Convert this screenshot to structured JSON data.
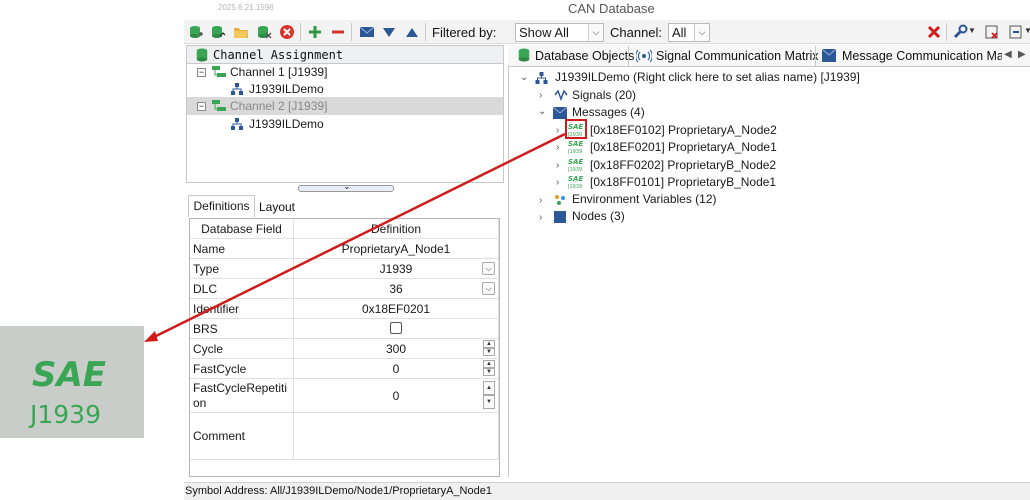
{
  "window": {
    "version": "2025.6.21.1598",
    "title": "CAN Database"
  },
  "toolbar": {
    "filter_label": "Filtered by:",
    "filter_value": "Show All",
    "channel_label": "Channel:",
    "channel_value": "All",
    "icons": [
      "db-add-icon",
      "db-add-alt-icon",
      "folder-open-icon",
      "db-remove-icon",
      "delete-icon",
      "add-icon",
      "remove-icon",
      "mail-icon",
      "arrow-down-icon",
      "arrow-up-icon",
      "close-icon",
      "wrench-icon",
      "export-icon",
      "import-icon"
    ]
  },
  "channel_pane": {
    "title": "Channel Assignment",
    "items": [
      {
        "label": "Channel 1 [J1939]",
        "child": "J1939ILDemo"
      },
      {
        "label": "Channel 2 [J1939]",
        "child": "J1939ILDemo"
      }
    ]
  },
  "def_tabs": [
    "Definitions",
    "Layout"
  ],
  "definitions": {
    "headers": [
      "Database Field",
      "Definition"
    ],
    "rows": [
      {
        "field": "Name",
        "value": "ProprietaryA_Node1"
      },
      {
        "field": "Type",
        "value": "J1939"
      },
      {
        "field": "DLC",
        "value": "36"
      },
      {
        "field": "Identifier",
        "value": "0x18EF0201"
      },
      {
        "field": "BRS",
        "value": ""
      },
      {
        "field": "Cycle",
        "value": "300"
      },
      {
        "field": "FastCycle",
        "value": "0"
      },
      {
        "field": "FastCycleRepetition",
        "value": "0"
      },
      {
        "field": "Comment",
        "value": ""
      }
    ],
    "brs_checked": false
  },
  "right_tabs": [
    "Database Objects",
    "Signal Communication Matrix",
    "Message Communication Matr"
  ],
  "db_tree": {
    "root": "J1939ILDemo (Right click here to set alias name) [J1939]",
    "signals": "Signals (20)",
    "messages": "Messages (4)",
    "message_items": [
      "[0x18EF0102] ProprietaryA_Node2",
      "[0x18EF0201] ProprietaryA_Node1",
      "[0x18FF0202] ProprietaryB_Node2",
      "[0x18FF0101] ProprietaryB_Node1"
    ],
    "env": "Environment Variables (12)",
    "nodes": "Nodes (3)"
  },
  "status": {
    "text": "Symbol Address: All/J1939ILDemo/Node1/ProprietaryA_Node1"
  },
  "zoom": {
    "line1": "SAE",
    "line2": "J1939"
  },
  "colors": {
    "accent_green": "#3aa655",
    "highlight_red": "#d11a1a",
    "tree_blue": "#2b5797"
  }
}
